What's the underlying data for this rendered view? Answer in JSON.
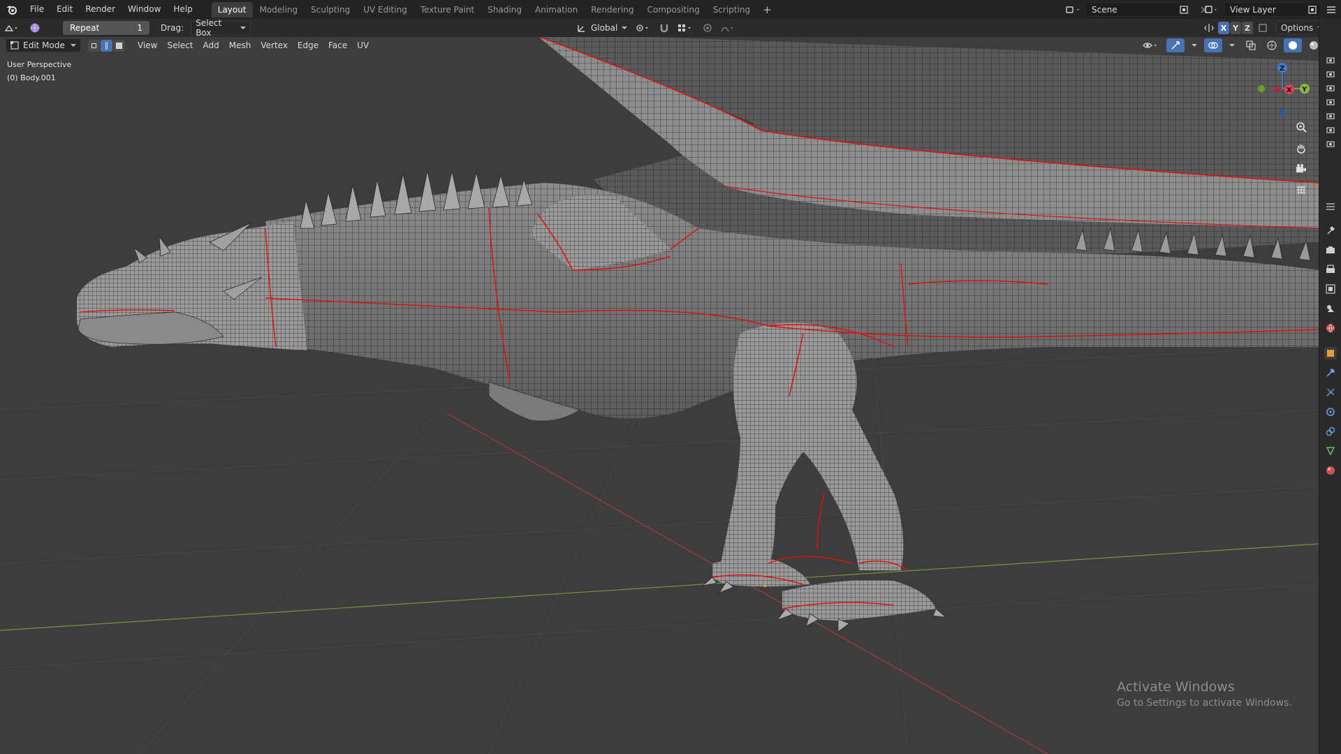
{
  "app": {
    "menus": [
      "File",
      "Edit",
      "Render",
      "Window",
      "Help"
    ],
    "workspaces": [
      "Layout",
      "Modeling",
      "Sculpting",
      "UV Editing",
      "Texture Paint",
      "Shading",
      "Animation",
      "Rendering",
      "Compositing",
      "Scripting"
    ],
    "active_workspace": "Layout",
    "add_workspace": "+",
    "scene": "Scene",
    "view_layer": "View Layer"
  },
  "toolbar": {
    "last_op_label": "Repeat",
    "last_op_value": "1",
    "drag_label": "Drag:",
    "drag_value": "Select Box",
    "transform_orientation": "Global",
    "options_label": "Options",
    "axis_x": "X",
    "axis_y": "Y",
    "axis_z": "Z"
  },
  "header": {
    "mode": "Edit Mode",
    "menus": [
      "View",
      "Select",
      "Add",
      "Mesh",
      "Vertex",
      "Edge",
      "Face",
      "UV"
    ]
  },
  "viewport": {
    "view_name": "User Perspective",
    "object_name": "(0) Body.001",
    "gizmo": {
      "x": "X",
      "y": "Y",
      "z": "Z"
    },
    "colors": {
      "background": "#3d3d3d",
      "grid": "#4a4a4a",
      "x_axis": "#c43c3c",
      "y_axis": "#6e9a3a",
      "seam": "#e01010",
      "mesh_fill": "#8f8f8f",
      "wire": "#2a2a2a"
    }
  },
  "watermark": {
    "title": "Activate Windows",
    "subtitle": "Go to Settings to activate Windows."
  },
  "properties_tabs": [
    "tool-icon",
    "render-icon",
    "output-icon",
    "view-layer-icon",
    "scene-icon",
    "world-icon",
    "object-icon",
    "modifier-icon",
    "particles-icon",
    "physics-icon",
    "constraints-icon",
    "data-icon",
    "material-icon"
  ]
}
